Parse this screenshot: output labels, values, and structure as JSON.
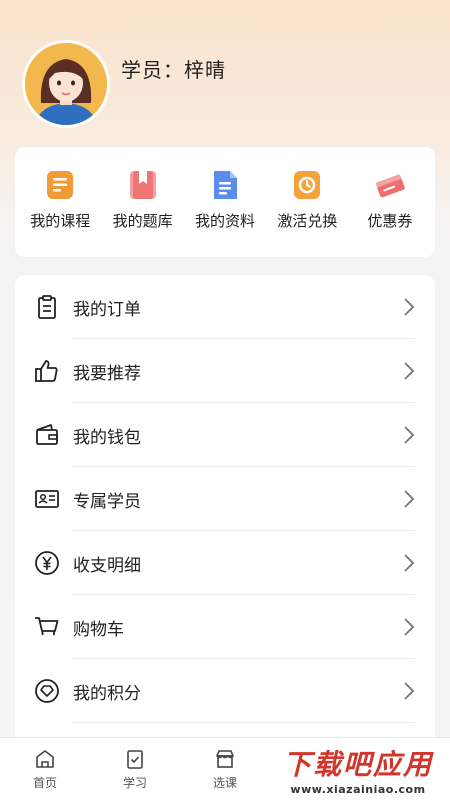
{
  "profile": {
    "name": "学员：梓晴"
  },
  "quick_links": [
    {
      "label": "我的课程",
      "icon": "course-icon",
      "color": "#f29a38"
    },
    {
      "label": "我的题库",
      "icon": "question-bank-icon",
      "color": "#f07a7a"
    },
    {
      "label": "我的资料",
      "icon": "document-icon",
      "color": "#5b8def"
    },
    {
      "label": "激活兑换",
      "icon": "activate-icon",
      "color": "#f5a23a"
    },
    {
      "label": "优惠券",
      "icon": "coupon-icon",
      "color": "#f07070"
    }
  ],
  "menu": [
    {
      "label": "我的订单",
      "icon": "clipboard-icon"
    },
    {
      "label": "我要推荐",
      "icon": "thumbs-up-icon"
    },
    {
      "label": "我的钱包",
      "icon": "wallet-icon"
    },
    {
      "label": "专属学员",
      "icon": "id-card-icon"
    },
    {
      "label": "收支明细",
      "icon": "yen-icon"
    },
    {
      "label": "购物车",
      "icon": "cart-icon"
    },
    {
      "label": "我的积分",
      "icon": "points-icon"
    },
    {
      "label": "",
      "icon": ""
    }
  ],
  "tabbar": [
    {
      "label": "首页",
      "icon": "home-icon"
    },
    {
      "label": "学习",
      "icon": "study-icon"
    },
    {
      "label": "选课",
      "icon": "shop-icon"
    }
  ],
  "watermark": {
    "title": "下载吧应用",
    "subtitle": "www.xiazainiao.com"
  }
}
